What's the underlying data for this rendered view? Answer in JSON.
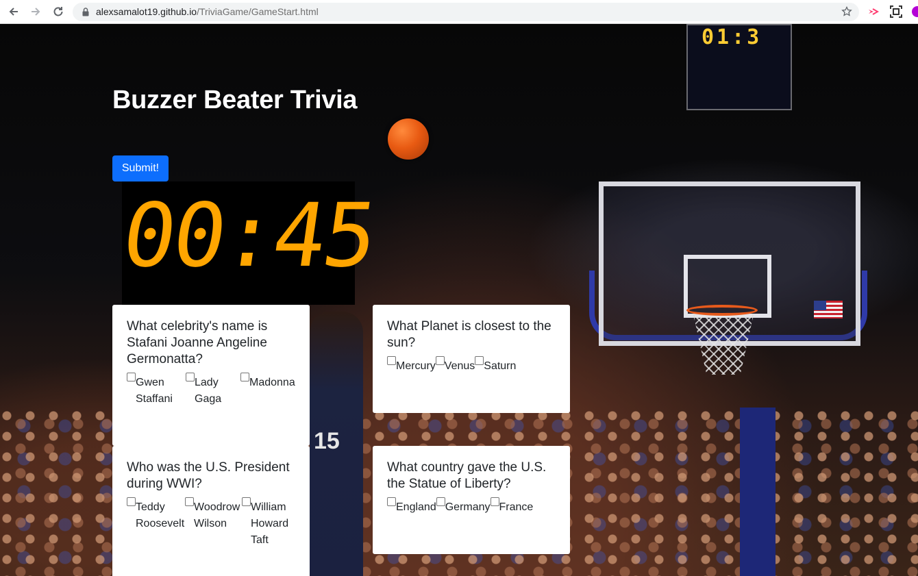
{
  "browser": {
    "url_host": "alexsamalot19.github.io",
    "url_path": "/TriviaGame/GameStart.html",
    "icons": [
      "back-icon",
      "forward-icon",
      "reload-icon",
      "lock-icon",
      "star-icon",
      "extension-icon",
      "screenshot-icon",
      "profile-icon"
    ]
  },
  "page": {
    "title": "Buzzer Beater Trivia",
    "submit_label": "Submit!",
    "timer": "00:45",
    "scoreboard_digits": "01:3",
    "jersey_number": "15",
    "accent_color": "#ffa500",
    "button_color": "#0d6efd"
  },
  "questions": [
    {
      "question": "What celebrity's name is Stafani Joanne Angeline Germonatta?",
      "options": [
        "Gwen Staffani",
        "Lady Gaga",
        "Madonna"
      ]
    },
    {
      "question": "What Planet is closest to the sun?",
      "options": [
        "Mercury",
        "Venus",
        "Saturn"
      ]
    },
    {
      "question": "Who was the U.S. President during WWI?",
      "options": [
        "Teddy Roosevelt",
        "Woodrow Wilson",
        "William Howard Taft"
      ]
    },
    {
      "question": "What country gave the U.S. the Statue of Liberty?",
      "options": [
        "England",
        "Germany",
        "France"
      ]
    }
  ]
}
